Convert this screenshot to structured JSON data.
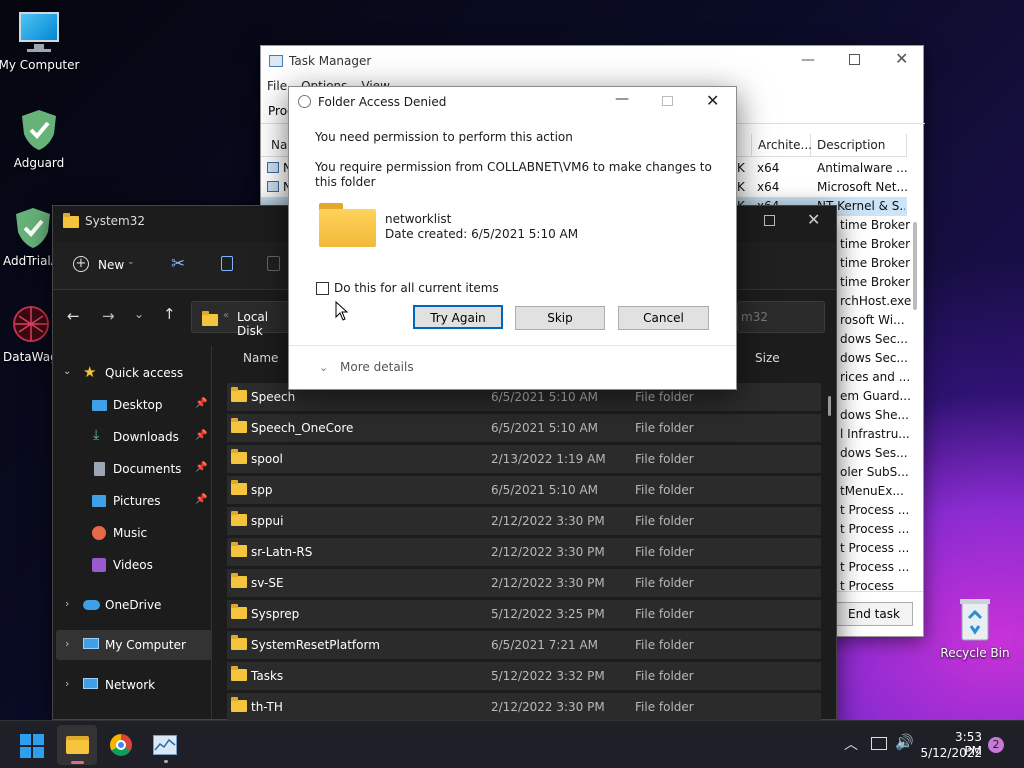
{
  "desktop": {
    "icons": [
      {
        "label": "My Computer"
      },
      {
        "label": "Adguard"
      },
      {
        "label": "AddTrialA"
      },
      {
        "label": "DataWag"
      },
      {
        "label": "Recycle Bin"
      }
    ]
  },
  "task_manager": {
    "title": "Task Manager",
    "menu": [
      "File",
      "Options",
      "View"
    ],
    "tab_partial": "Proc",
    "columns": {
      "name": "Na",
      "arch": "Archite...",
      "desc": "Description"
    },
    "rows": [
      {
        "name": "N",
        "k": "K",
        "arch": "x64",
        "desc": "Antimalware ..."
      },
      {
        "name": "N",
        "k": "K",
        "arch": "x64",
        "desc": "Microsoft Net..."
      },
      {
        "name": "",
        "k": "K",
        "arch": "x64",
        "desc": "NT Kernel & S..."
      },
      {
        "desc": "time Broker"
      },
      {
        "desc": "time Broker"
      },
      {
        "desc": "time Broker"
      },
      {
        "desc": "time Broker"
      },
      {
        "desc": "rchHost.exe"
      },
      {
        "desc": "rosoft Wi..."
      },
      {
        "desc": "dows Sec..."
      },
      {
        "desc": "dows Sec..."
      },
      {
        "desc": "rices and ..."
      },
      {
        "desc": "em Guard..."
      },
      {
        "desc": "dows She..."
      },
      {
        "desc": "l Infrastru..."
      },
      {
        "desc": "dows Ses..."
      },
      {
        "desc": "oler SubS..."
      },
      {
        "desc": "tMenuEx..."
      },
      {
        "desc": "t Process ..."
      },
      {
        "desc": "t Process ..."
      },
      {
        "desc": "t Process ..."
      },
      {
        "desc": "t Process ..."
      },
      {
        "desc": "t Process"
      }
    ],
    "end_task": "End task"
  },
  "explorer": {
    "title": "System32",
    "new_label": "New",
    "address": "Local Disk",
    "search_partial": "m32",
    "col_name": "Name",
    "col_size": "Size",
    "nav": [
      {
        "label": "Quick access"
      },
      {
        "label": "Desktop"
      },
      {
        "label": "Downloads"
      },
      {
        "label": "Documents"
      },
      {
        "label": "Pictures"
      },
      {
        "label": "Music"
      },
      {
        "label": "Videos"
      },
      {
        "label": "OneDrive"
      },
      {
        "label": "My Computer"
      },
      {
        "label": "Network"
      }
    ],
    "rows": [
      {
        "name": "Speech",
        "date": "6/5/2021 5:10 AM",
        "type": "File folder"
      },
      {
        "name": "Speech_OneCore",
        "date": "6/5/2021 5:10 AM",
        "type": "File folder"
      },
      {
        "name": "spool",
        "date": "2/13/2022 1:19 AM",
        "type": "File folder"
      },
      {
        "name": "spp",
        "date": "6/5/2021 5:10 AM",
        "type": "File folder"
      },
      {
        "name": "sppui",
        "date": "2/12/2022 3:30 PM",
        "type": "File folder"
      },
      {
        "name": "sr-Latn-RS",
        "date": "2/12/2022 3:30 PM",
        "type": "File folder"
      },
      {
        "name": "sv-SE",
        "date": "2/12/2022 3:30 PM",
        "type": "File folder"
      },
      {
        "name": "Sysprep",
        "date": "5/12/2022 3:25 PM",
        "type": "File folder"
      },
      {
        "name": "SystemResetPlatform",
        "date": "6/5/2021 7:21 AM",
        "type": "File folder"
      },
      {
        "name": "Tasks",
        "date": "5/12/2022 3:32 PM",
        "type": "File folder"
      },
      {
        "name": "th-TH",
        "date": "2/12/2022 3:30 PM",
        "type": "File folder"
      }
    ]
  },
  "dialog": {
    "title": "Folder Access Denied",
    "heading": "You need permission to perform this action",
    "message": "You require permission from COLLABNET\\VM6 to make changes to this folder",
    "item_name": "networklist",
    "item_date": "Date created: 6/5/2021 5:10 AM",
    "checkbox_label": "Do this for all current items",
    "try_again": "Try Again",
    "skip": "Skip",
    "cancel": "Cancel",
    "more_details": "More details"
  },
  "taskbar": {
    "time": "3:53 PM",
    "date": "5/12/2022",
    "notification_count": "2"
  },
  "colors": {
    "accent": "#0067c0",
    "folder": "#f4c43c",
    "explorer_bg": "#1c1c1c"
  }
}
